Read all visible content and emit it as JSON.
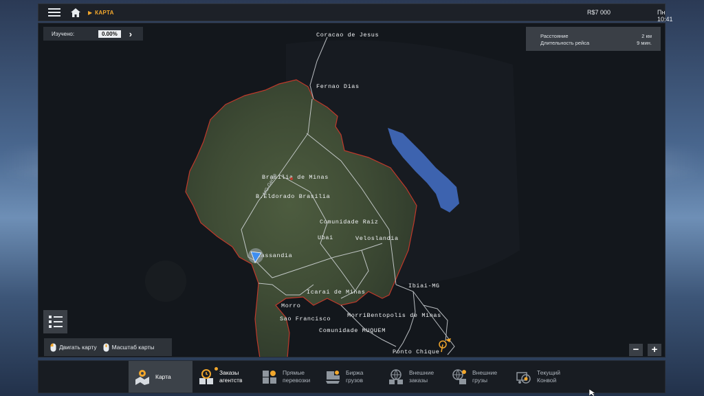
{
  "topbar": {
    "breadcrumb": "КАРТА",
    "money": "R$7 000",
    "clock": "Пн 10:41"
  },
  "map": {
    "explored_label": "Изучено:",
    "explored_value": "0.00%",
    "trip_info": {
      "distance_label": "Расстояние",
      "distance_value": "2 км",
      "duration_label": "Длительность рейса",
      "duration_value": "9 мин."
    },
    "road_label": "MG-Gerais",
    "cities": [
      "Coracao de Jesus",
      "Fernao Dias",
      "Brasilia de Minas",
      "B.Eldorado Brasilia",
      "Comunidade Raiz",
      "Ubai",
      "Veloslandia",
      "Lassandia",
      "Icarai de Minas",
      "Ibiai-MG",
      "Morro",
      "Sao Francisco",
      "MorriBentopolis de Minas",
      "Comunidade MUQUEM",
      "Ponto Chique"
    ],
    "hints": {
      "move": "Двигать карту",
      "zoom": "Масштаб карты"
    },
    "zoom_minus": "−",
    "zoom_plus": "+"
  },
  "nav": {
    "tabs": [
      {
        "line1": "Карта",
        "line2": "",
        "icon": "map-pin-icon"
      },
      {
        "line1": "Заказы",
        "line2": "агентств",
        "icon": "clock-boxes-icon"
      },
      {
        "line1": "Прямые",
        "line2": "перевозки",
        "icon": "boxes-icon"
      },
      {
        "line1": "Биржа",
        "line2": "грузов",
        "icon": "cargo-hand-icon"
      },
      {
        "line1": "Внешние",
        "line2": "заказы",
        "icon": "globe-boxes-icon"
      },
      {
        "line1": "Внешние",
        "line2": "грузы",
        "icon": "globe-cargo-icon"
      },
      {
        "line1": "Текущий",
        "line2": "Конвой",
        "icon": "convoy-icon"
      }
    ]
  },
  "colors": {
    "accent": "#f2a72c",
    "border_red": "#c0392b",
    "lake": "#4470c8",
    "player": "#3f8ef0"
  }
}
